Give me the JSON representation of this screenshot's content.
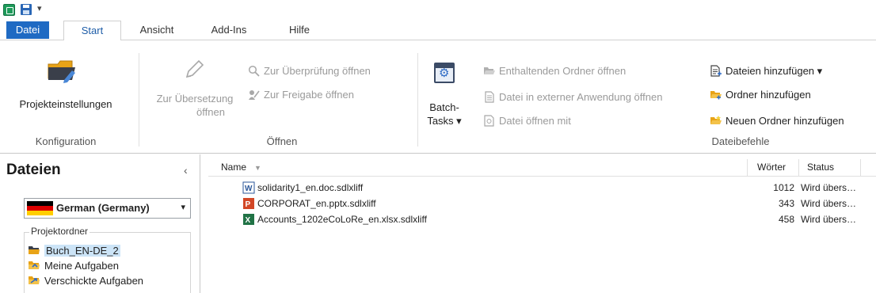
{
  "ribbon_tabs": [
    "Datei",
    "Start",
    "Ansicht",
    "Add-Ins",
    "Hilfe"
  ],
  "groups": {
    "konfiguration": {
      "label": "Konfiguration",
      "projekteinstellungen": "Projekteinstellungen"
    },
    "oeffnen": {
      "label": "Öffnen",
      "zur_uebersetzung_line1": "Zur Übersetzung",
      "zur_uebersetzung_line2": "öffnen",
      "zur_ueberpruefung": "Zur Überprüfung öffnen",
      "zur_freigabe": "Zur Freigabe öffnen"
    },
    "batch": {
      "line1": "Batch-",
      "line2": "Tasks ▾"
    },
    "dateibefehle": {
      "label": "Dateibefehle",
      "enthaltenden_ordner": "Enthaltenden Ordner öffnen",
      "externe_anwendung": "Datei in externer Anwendung öffnen",
      "oeffnen_mit": "Datei öffnen mit",
      "dateien_hinzufuegen": "Dateien hinzufügen ▾",
      "ordner_hinzufuegen": "Ordner hinzufügen",
      "neuen_ordner": "Neuen Ordner hinzufügen"
    }
  },
  "leftpane": {
    "title": "Dateien",
    "collapse": "‹",
    "language": "German (Germany)",
    "language_arrow": "▾",
    "projektordner_legend": "Projektordner",
    "items": [
      "Buch_EN-DE_2",
      "Meine Aufgaben",
      "Verschickte Aufgaben"
    ]
  },
  "filelist": {
    "columns": {
      "name": "Name",
      "sort_arrow": "▼",
      "words": "Wörter",
      "status": "Status"
    },
    "rows": [
      {
        "name": "solidarity1_en.doc.sdlxliff",
        "words": "1012",
        "status": "Wird übers…",
        "icon": "word-icon"
      },
      {
        "name": "CORPORAT_en.pptx.sdlxliff",
        "words": "343",
        "status": "Wird übers…",
        "icon": "powerpoint-icon"
      },
      {
        "name": "Accounts_1202eCoLoRe_en.xlsx.sdlxliff",
        "words": "458",
        "status": "Wird übers…",
        "icon": "excel-icon"
      }
    ]
  },
  "colors": {
    "accent": "#1f6ac3",
    "selection": "#cce4f7",
    "word": "#2b579a",
    "powerpoint": "#d24726",
    "excel": "#217346"
  }
}
